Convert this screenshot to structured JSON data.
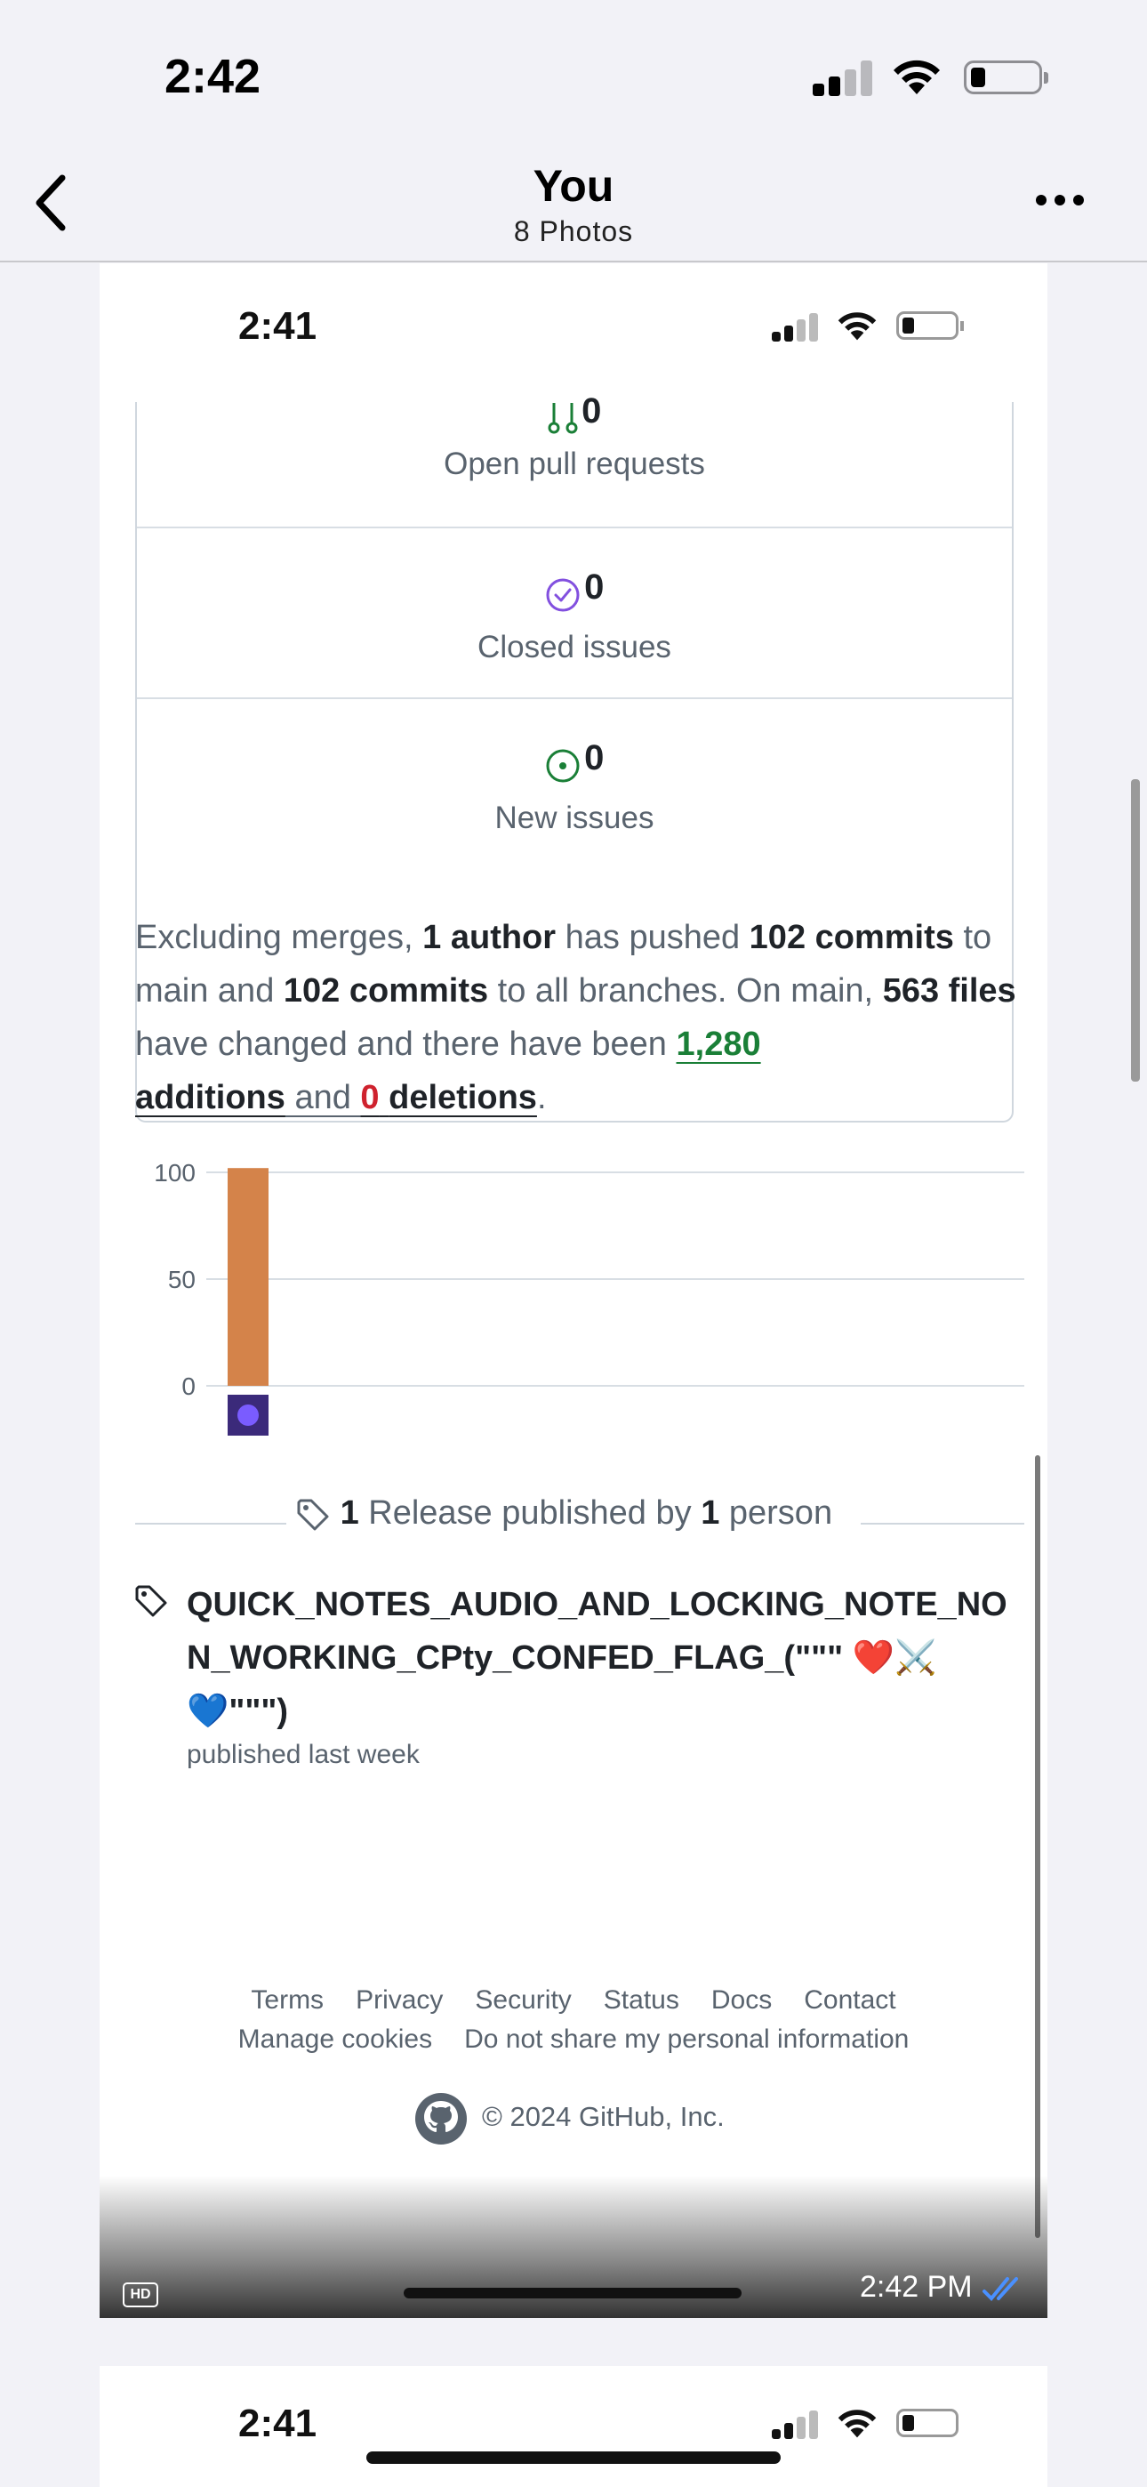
{
  "status_bar": {
    "time": "2:42"
  },
  "nav": {
    "title": "You",
    "subtitle": "8 Photos"
  },
  "photo": {
    "status_time": "2:41",
    "stats": [
      {
        "icon": "pull-request-icon",
        "value": "0",
        "label": "Open pull requests"
      },
      {
        "icon": "closed-issue-icon",
        "value": "0",
        "label": "Closed issues"
      },
      {
        "icon": "new-issue-icon",
        "value": "0",
        "label": "New issues"
      }
    ],
    "summary": {
      "p1": "Excluding merges, ",
      "authors": "1 author",
      "p2": " has pushed ",
      "commits_main": "102 commits",
      "p3": " to main and ",
      "commits_all": "102 commits",
      "p4": " to all branches. On main, ",
      "files": "563 files",
      "p5": " have changed and there have been ",
      "additions_num": "1,280",
      "additions_word": "additions",
      "p6": " and ",
      "deletions_num": "0",
      "deletions_word": "deletions",
      "p7": "."
    },
    "release": {
      "count": "1",
      "middle": " Release published by ",
      "people": "1",
      "tail": " person",
      "title": "QUICK_NOTES_AUDIO_AND_LOCKING_NOTE_NON_WORKING_CPty_CONFED_FLAG_(\"\"\" ❤️⚔️💙\"\"\")",
      "date": "published last week"
    },
    "footer": {
      "links_row1": [
        "Terms",
        "Privacy",
        "Security",
        "Status",
        "Docs",
        "Contact"
      ],
      "links_row2": [
        "Manage cookies",
        "Do not share my personal information"
      ],
      "copyright": "© 2024 GitHub, Inc."
    },
    "message_time": "2:42 PM",
    "hd_badge": "HD"
  },
  "next_photo": {
    "status_time": "2:41"
  },
  "chart_data": {
    "type": "bar",
    "categories": [
      "author"
    ],
    "values": [
      102
    ],
    "ylim": [
      0,
      100
    ],
    "yticks": [
      0,
      50,
      100
    ],
    "bar_color": "#d4834a",
    "grid": true
  }
}
